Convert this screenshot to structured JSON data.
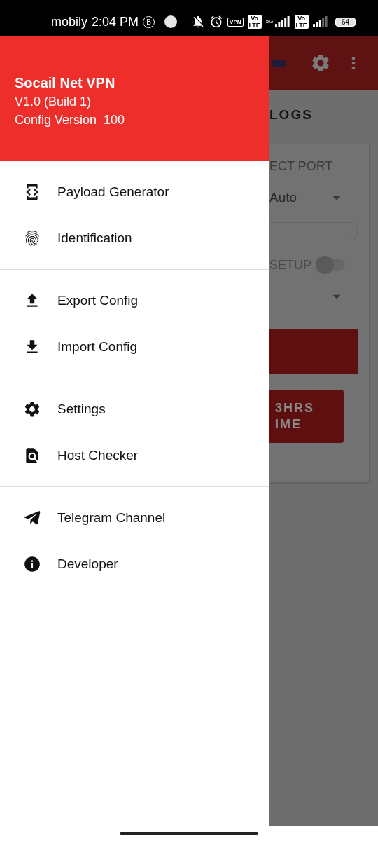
{
  "status_bar": {
    "carrier": "mobily",
    "time": "2:04 PM",
    "business_badge": "B",
    "vpn_badge": "VPN",
    "volte_badges": [
      {
        "top": "Vo",
        "bottom": "LTE"
      },
      {
        "top": "Vo",
        "bottom": "LTE"
      }
    ],
    "network": "5G",
    "battery": "64"
  },
  "drawer": {
    "header": {
      "title": "Socail Net VPN",
      "version": "V1.0 (Build 1)",
      "config_version": "Config Version  100"
    },
    "sections": [
      {
        "items": [
          {
            "kind": "code",
            "label": "Payload Generator"
          },
          {
            "kind": "fingerprint",
            "label": "Identification"
          }
        ]
      },
      {
        "items": [
          {
            "kind": "upload",
            "label": "Export Config"
          },
          {
            "kind": "download",
            "label": "Import Config"
          }
        ]
      },
      {
        "items": [
          {
            "kind": "settings",
            "label": "Settings"
          },
          {
            "kind": "find",
            "label": "Host Checker"
          }
        ]
      },
      {
        "items": [
          {
            "kind": "send",
            "label": "Telegram Channel"
          },
          {
            "kind": "info",
            "label": "Developer"
          }
        ]
      }
    ]
  },
  "background": {
    "tab": "LOGS",
    "port_label": "ECT PORT",
    "port_value": "Auto",
    "setup_label": "SETUP",
    "setup_toggle": {
      "on": false
    },
    "second_button_lines": [
      "3HRS",
      "IME"
    ]
  }
}
